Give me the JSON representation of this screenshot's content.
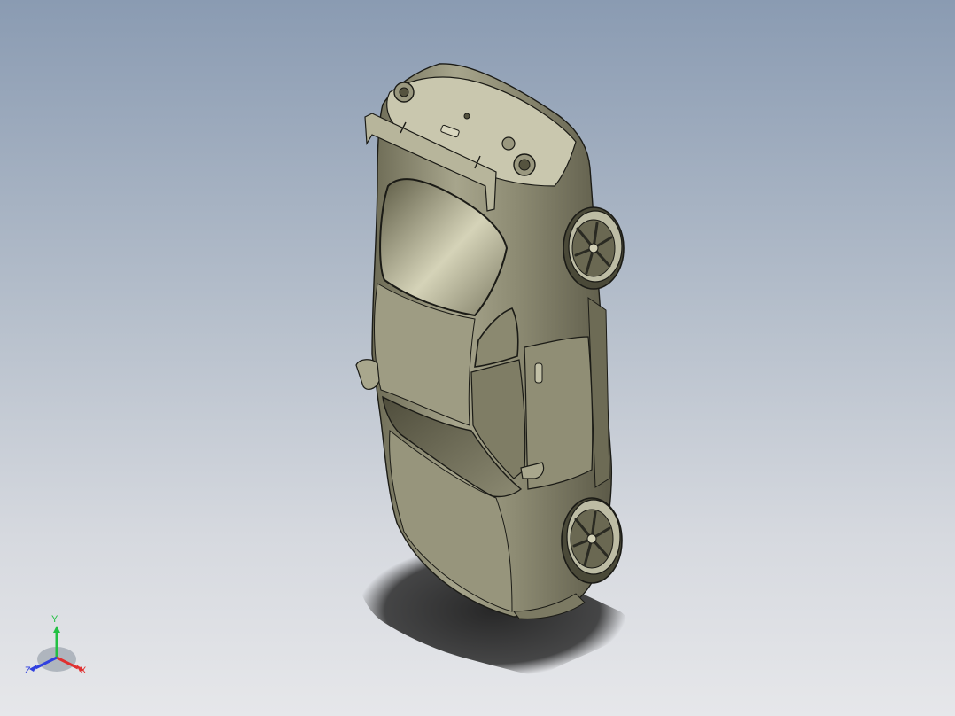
{
  "viewport": {
    "background_top": "#8a9bb2",
    "background_bottom": "#e6e7ea",
    "model_body_color": "#8d8b73",
    "model_edge_color": "#1b1b16"
  },
  "triad": {
    "x_label": "X",
    "y_label": "Y",
    "z_label": "Z",
    "x_color": "#e03030",
    "y_color": "#22c043",
    "z_color": "#3040e0"
  }
}
